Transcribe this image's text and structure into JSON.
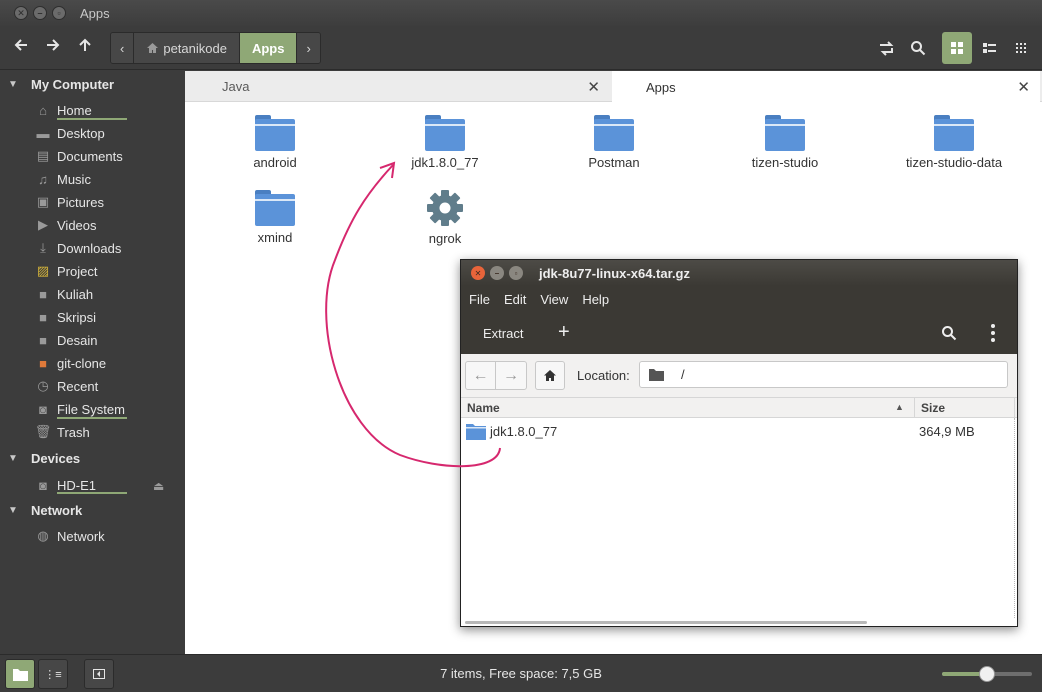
{
  "window": {
    "title": "Apps"
  },
  "toolbar": {
    "breadcrumb": [
      {
        "label": "petanikode",
        "icon": "home-icon",
        "active": false
      },
      {
        "label": "Apps",
        "active": true
      }
    ]
  },
  "sidebar": {
    "sections": [
      {
        "title": "My Computer",
        "items": [
          {
            "label": "Home",
            "icon": "home-icon"
          },
          {
            "label": "Desktop",
            "icon": "desktop-icon"
          },
          {
            "label": "Documents",
            "icon": "document-icon"
          },
          {
            "label": "Music",
            "icon": "music-icon"
          },
          {
            "label": "Pictures",
            "icon": "pictures-icon"
          },
          {
            "label": "Videos",
            "icon": "videos-icon"
          },
          {
            "label": "Downloads",
            "icon": "download-icon"
          },
          {
            "label": "Project",
            "icon": "project-icon"
          },
          {
            "label": "Kuliah",
            "icon": "folder-icon"
          },
          {
            "label": "Skripsi",
            "icon": "folder-icon"
          },
          {
            "label": "Desain",
            "icon": "folder-icon"
          },
          {
            "label": "git-clone",
            "icon": "git-folder-icon"
          },
          {
            "label": "Recent",
            "icon": "clock-icon"
          },
          {
            "label": "File System",
            "icon": "drive-icon"
          },
          {
            "label": "Trash",
            "icon": "trash-icon"
          }
        ]
      },
      {
        "title": "Devices",
        "items": [
          {
            "label": "HD-E1",
            "icon": "drive-icon"
          }
        ]
      },
      {
        "title": "Network",
        "items": [
          {
            "label": "Network",
            "icon": "network-icon"
          }
        ]
      }
    ]
  },
  "tabs": [
    {
      "label": "Java",
      "active": false
    },
    {
      "label": "Apps",
      "active": true
    }
  ],
  "files": [
    {
      "name": "android",
      "type": "folder"
    },
    {
      "name": "jdk1.8.0_77",
      "type": "folder"
    },
    {
      "name": "Postman",
      "type": "folder"
    },
    {
      "name": "tizen-studio",
      "type": "folder"
    },
    {
      "name": "tizen-studio-data",
      "type": "folder"
    },
    {
      "name": "xmind",
      "type": "folder"
    },
    {
      "name": "ngrok",
      "type": "gear-executable"
    }
  ],
  "archive": {
    "title": "jdk-8u77-linux-x64.tar.gz",
    "menu": [
      "File",
      "Edit",
      "View",
      "Help"
    ],
    "extract_label": "Extract",
    "add_label": "+",
    "location_label": "Location:",
    "location_value": "/",
    "columns": {
      "name": "Name",
      "size": "Size"
    },
    "rows": [
      {
        "name": "jdk1.8.0_77",
        "size": "364,9 MB"
      }
    ]
  },
  "status": {
    "text": "7 items, Free space: 7,5 GB",
    "zoom_fraction": 0.5
  },
  "colors": {
    "accent": "#8fa876",
    "folder": "#5b93d9",
    "arrow": "#d6286e",
    "archive_close": "#e8643a"
  }
}
